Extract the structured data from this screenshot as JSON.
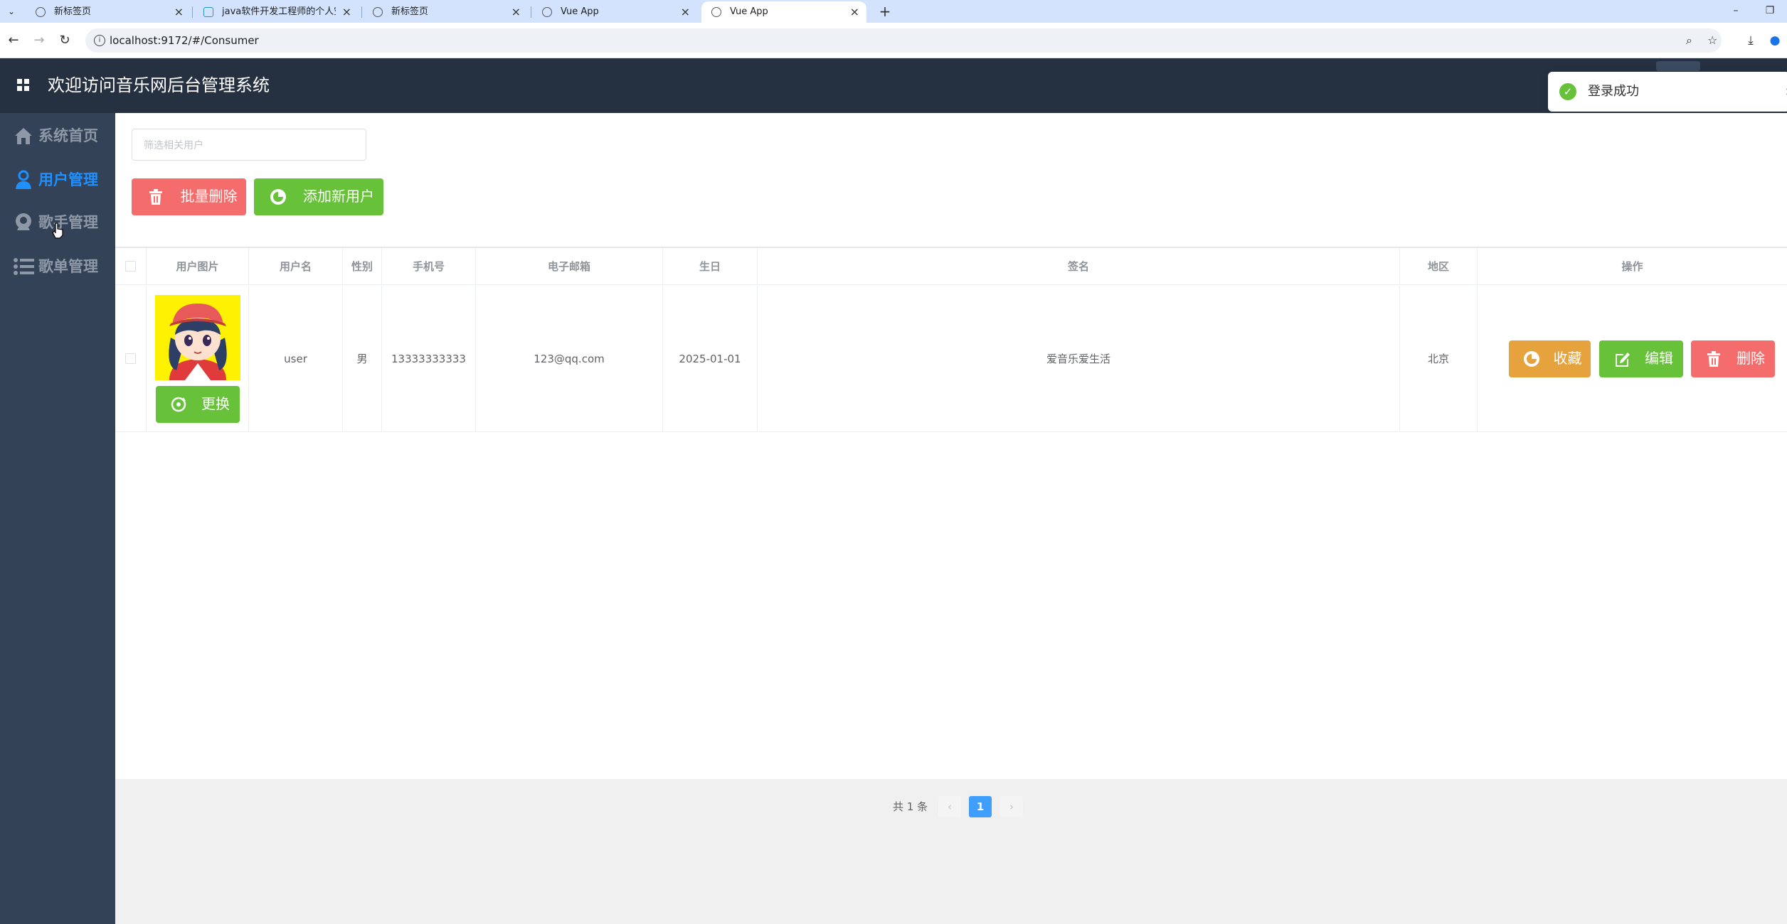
{
  "browser": {
    "tabs": [
      {
        "title": "新标签页",
        "active": false
      },
      {
        "title": "java软件开发工程师的个人空间",
        "active": false
      },
      {
        "title": "新标签页",
        "active": false
      },
      {
        "title": "Vue App",
        "active": false
      },
      {
        "title": "Vue App",
        "active": true
      }
    ],
    "url": "localhost:9172/#/Consumer"
  },
  "header": {
    "title": "欢迎访问音乐网后台管理系统"
  },
  "toast": {
    "message": "登录成功"
  },
  "sidebar": {
    "items": [
      {
        "label": "系统首页",
        "icon": "home-icon",
        "active": false
      },
      {
        "label": "用户管理",
        "icon": "user-icon",
        "active": true
      },
      {
        "label": "歌手管理",
        "icon": "singer-icon",
        "active": false
      },
      {
        "label": "歌单管理",
        "icon": "list-icon",
        "active": false
      }
    ]
  },
  "toolbar": {
    "search_placeholder": "筛选相关用户",
    "batch_delete_label": "批量删除",
    "add_user_label": "添加新用户"
  },
  "table": {
    "columns": [
      "用户图片",
      "用户名",
      "性别",
      "手机号",
      "电子邮箱",
      "生日",
      "签名",
      "地区",
      "操作"
    ],
    "rows": [
      {
        "change_label": "更换",
        "username": "user",
        "gender": "男",
        "phone": "13333333333",
        "email": "123@qq.com",
        "birthday": "2025-01-01",
        "signature": "爱音乐爱生活",
        "region": "北京",
        "actions": {
          "collect": "收藏",
          "edit": "编辑",
          "delete": "删除"
        }
      }
    ]
  },
  "pagination": {
    "total_text": "共 1 条",
    "current_page": "1",
    "prev": "‹",
    "next": "›"
  },
  "colors": {
    "header_bg": "#253041",
    "sidebar_bg": "#334256",
    "active_blue": "#1e90ff",
    "danger": "#f56c6c",
    "success": "#67c23a",
    "warning": "#e6a23c",
    "primary": "#409eff"
  }
}
